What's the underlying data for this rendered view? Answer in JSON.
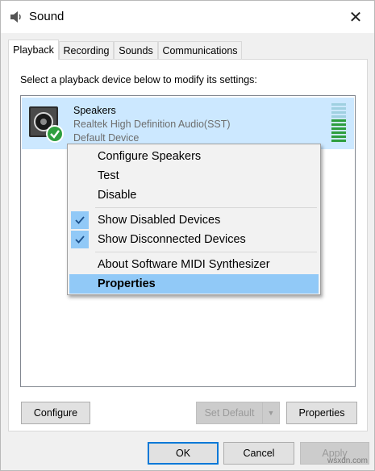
{
  "window": {
    "title": "Sound",
    "close_icon": "close-icon",
    "app_icon": "sound-speaker-icon"
  },
  "tabs": [
    {
      "label": "Playback",
      "active": true
    },
    {
      "label": "Recording",
      "active": false
    },
    {
      "label": "Sounds",
      "active": false
    },
    {
      "label": "Communications",
      "active": false
    }
  ],
  "panel": {
    "instruction": "Select a playback device below to modify its settings:"
  },
  "device": {
    "name": "Speakers",
    "driver": "Realtek High Definition Audio(SST)",
    "status": "Default Device",
    "icon": "speaker-icon",
    "badge_icon": "default-check-icon",
    "level_meter_icon": "volume-level-meter",
    "level_fraction": 0.55
  },
  "context_menu": {
    "items": [
      {
        "label": "Configure Speakers",
        "checked": false,
        "highlighted": false
      },
      {
        "label": "Test",
        "checked": false,
        "highlighted": false
      },
      {
        "label": "Disable",
        "checked": false,
        "highlighted": false
      },
      {
        "label": "Show Disabled Devices",
        "checked": true,
        "highlighted": false
      },
      {
        "label": "Show Disconnected Devices",
        "checked": true,
        "highlighted": false
      },
      {
        "label": "About Software MIDI Synthesizer",
        "checked": false,
        "highlighted": false
      },
      {
        "label": "Properties",
        "checked": false,
        "highlighted": true
      }
    ]
  },
  "buttons": {
    "configure": "Configure",
    "set_default": "Set Default",
    "properties": "Properties",
    "ok": "OK",
    "cancel": "Cancel",
    "apply": "Apply"
  },
  "watermark": "wsxdn.com",
  "colors": {
    "selection": "#cce8ff",
    "menu_highlight": "#91c9f7",
    "default_button_border": "#0078d7",
    "check_badge": "#2e9e3e"
  }
}
